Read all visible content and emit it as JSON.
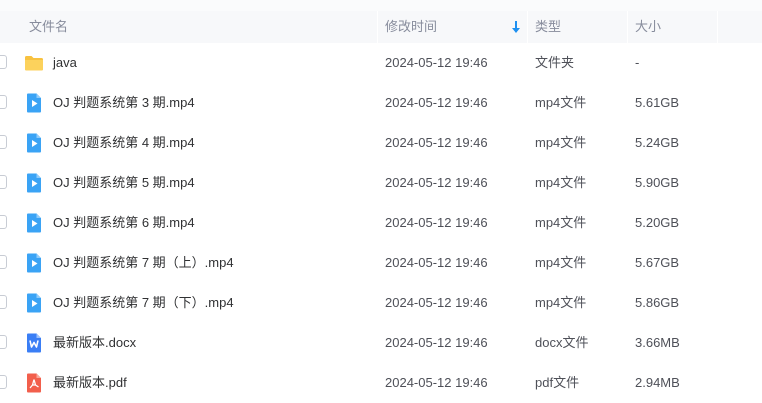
{
  "header": {
    "name_label": "文件名",
    "mtime_label": "修改时间",
    "type_label": "类型",
    "size_label": "大小"
  },
  "colors": {
    "folder": "#f8c240",
    "video": "#3aa3f5",
    "word": "#3a7ef5",
    "pdf": "#f25f4c",
    "sort_arrow": "#1e90f0"
  },
  "rows": [
    {
      "icon": "folder-icon",
      "name": "java",
      "mtime": "2024-05-12 19:46",
      "type": "文件夹",
      "size": "-"
    },
    {
      "icon": "video-file-icon",
      "name": "OJ 判题系统第 3 期.mp4",
      "mtime": "2024-05-12 19:46",
      "type": "mp4文件",
      "size": "5.61GB"
    },
    {
      "icon": "video-file-icon",
      "name": "OJ 判题系统第 4 期.mp4",
      "mtime": "2024-05-12 19:46",
      "type": "mp4文件",
      "size": "5.24GB"
    },
    {
      "icon": "video-file-icon",
      "name": "OJ 判题系统第 5 期.mp4",
      "mtime": "2024-05-12 19:46",
      "type": "mp4文件",
      "size": "5.90GB"
    },
    {
      "icon": "video-file-icon",
      "name": "OJ 判题系统第 6 期.mp4",
      "mtime": "2024-05-12 19:46",
      "type": "mp4文件",
      "size": "5.20GB"
    },
    {
      "icon": "video-file-icon",
      "name": "OJ 判题系统第 7 期（上）.mp4",
      "mtime": "2024-05-12 19:46",
      "type": "mp4文件",
      "size": "5.67GB"
    },
    {
      "icon": "video-file-icon",
      "name": "OJ 判题系统第 7 期（下）.mp4",
      "mtime": "2024-05-12 19:46",
      "type": "mp4文件",
      "size": "5.86GB"
    },
    {
      "icon": "word-file-icon",
      "name": "最新版本.docx",
      "mtime": "2024-05-12 19:46",
      "type": "docx文件",
      "size": "3.66MB"
    },
    {
      "icon": "pdf-file-icon",
      "name": "最新版本.pdf",
      "mtime": "2024-05-12 19:46",
      "type": "pdf文件",
      "size": "2.94MB"
    }
  ]
}
